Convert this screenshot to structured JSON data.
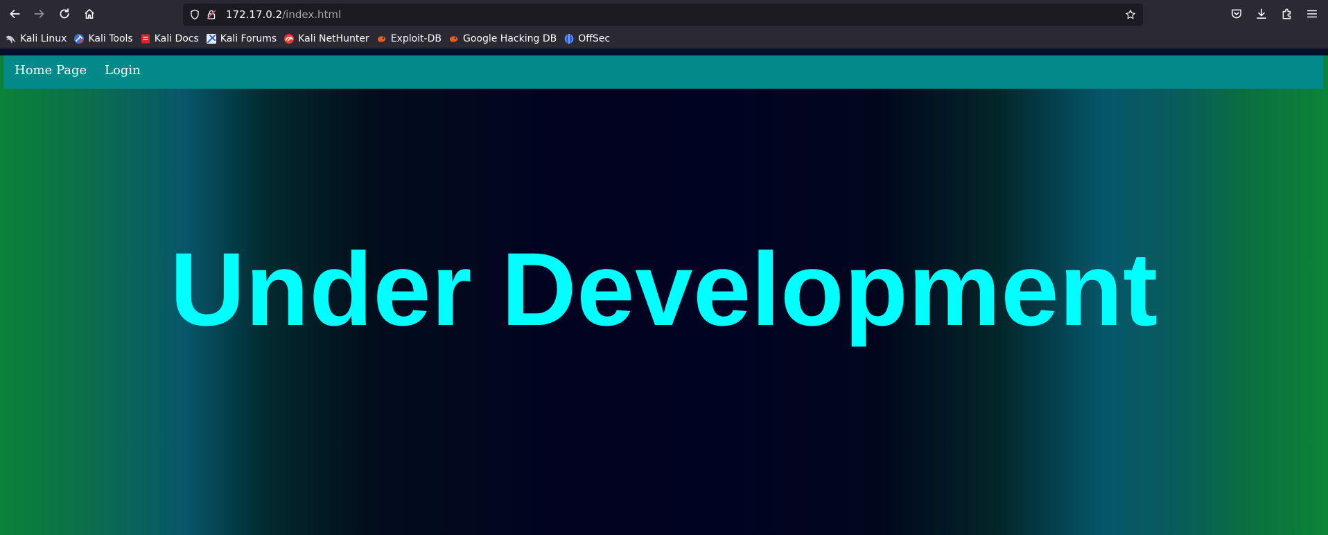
{
  "browser": {
    "url": {
      "host": "172.17.0.2",
      "path": "/index.html"
    },
    "bookmarks": [
      {
        "label": "Kali Linux",
        "icon": "kali-dragon-icon"
      },
      {
        "label": "Kali Tools",
        "icon": "kali-tools-icon"
      },
      {
        "label": "Kali Docs",
        "icon": "kali-docs-icon"
      },
      {
        "label": "Kali Forums",
        "icon": "kali-forums-icon"
      },
      {
        "label": "Kali NetHunter",
        "icon": "kali-nethunter-icon"
      },
      {
        "label": "Exploit-DB",
        "icon": "exploit-db-icon"
      },
      {
        "label": "Google Hacking DB",
        "icon": "google-hacking-db-icon"
      },
      {
        "label": "OffSec",
        "icon": "offsec-icon"
      }
    ]
  },
  "page": {
    "nav": {
      "home_label": "Home Page",
      "login_label": "Login"
    },
    "hero_text": "Under Development",
    "colors": {
      "navbar": "#028a8a",
      "hero_text": "#00ffff",
      "edge_green": "#0b8238",
      "center_navy": "#010320"
    }
  }
}
